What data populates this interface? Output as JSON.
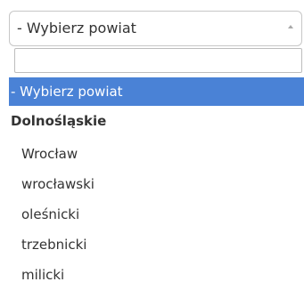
{
  "select": {
    "value": "- Wybierz powiat"
  },
  "search": {
    "value": ""
  },
  "options": [
    {
      "label": "- Wybierz powiat",
      "kind": "selected"
    },
    {
      "label": "Dolnośląskie",
      "kind": "group"
    },
    {
      "label": "Wrocław",
      "kind": "child"
    },
    {
      "label": "wrocławski",
      "kind": "child"
    },
    {
      "label": "oleśnicki",
      "kind": "child"
    },
    {
      "label": "trzebnicki",
      "kind": "child"
    },
    {
      "label": "milicki",
      "kind": "child"
    }
  ],
  "colors": {
    "selected_bg": "#4a82d6",
    "border": "#c7c7c7",
    "text": "#333333"
  },
  "icons": {
    "caret": "caret-up-icon"
  }
}
